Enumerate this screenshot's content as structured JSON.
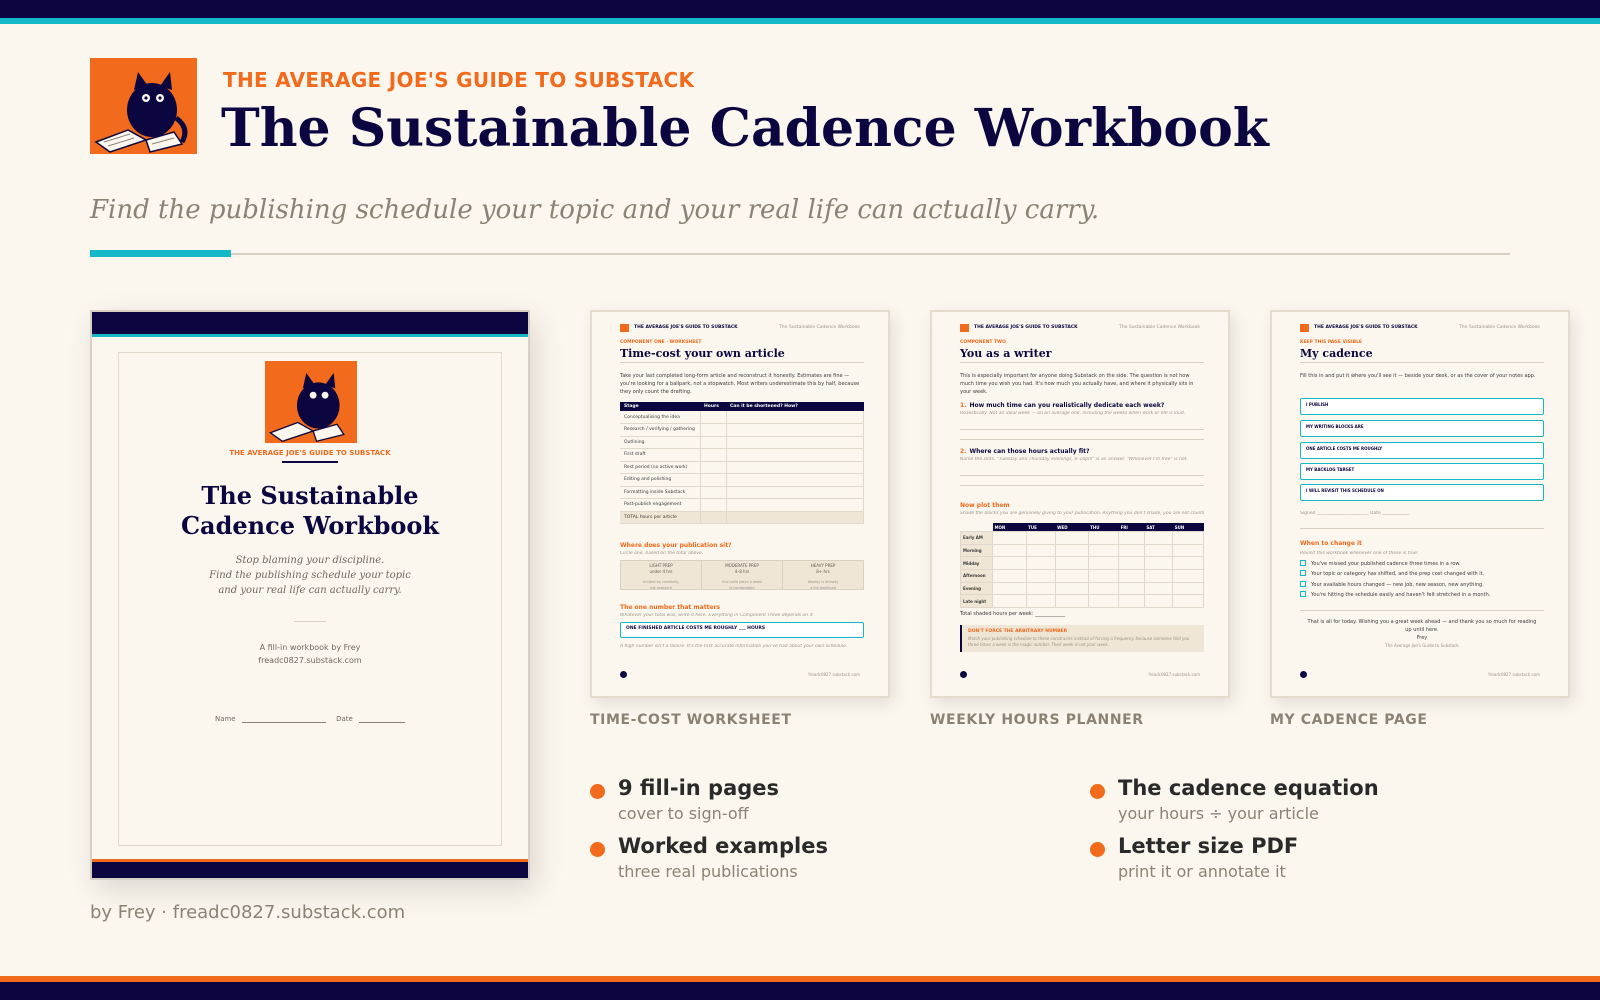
{
  "header": {
    "kicker": "THE AVERAGE JOE'S GUIDE TO SUBSTACK",
    "title": "The Sustainable Cadence Workbook",
    "subtitle": "Find the publishing schedule your topic and your real life can actually carry."
  },
  "cover": {
    "kicker": "THE AVERAGE JOE'S GUIDE TO SUBSTACK",
    "title_line1": "The Sustainable",
    "title_line2": "Cadence Workbook",
    "tagline_1": "Stop blaming your discipline.",
    "tagline_2": "Find the publishing schedule your topic",
    "tagline_3": "and your real life can actually carry.",
    "byline_1": "A fill-in workbook by Frey",
    "byline_2": "freadc0827.substack.com",
    "name_label": "Name",
    "date_label": "Date"
  },
  "byline": "by Frey  ·  freadc0827.substack.com",
  "pages": {
    "brand": "THE AVERAGE JOE'S GUIDE TO SUBSTACK",
    "brand_right": "The Sustainable Cadence Workbook",
    "footer_url": "freadc0827.substack.com",
    "timecost": {
      "label": "TIME-COST WORKSHEET",
      "kicker": "COMPONENT ONE · WORKSHEET",
      "title": "Time-cost your own article",
      "body": "Take your last completed long-form article and reconstruct it honestly. Estimates are fine — you're looking for a ballpark, not a stopwatch. Most writers underestimate this by half, because they only count the drafting.",
      "table_headers": [
        "Stage",
        "Hours",
        "Can it be shortened? How?"
      ],
      "stages": [
        "Conceptualising the idea",
        "Research / verifying / gathering",
        "Outlining",
        "First draft",
        "Rest period (no active work)",
        "Editing and polishing",
        "Formatting inside Substack",
        "Post-publish engagement"
      ],
      "total": "TOTAL hours per article",
      "sit_heading": "Where does your publication sit?",
      "sit_note": "Circle one, based on the total above.",
      "preps": [
        {
          "name": "LIGHT PREP",
          "range": "under 4 hrs",
          "note1": "Limited by creativity,",
          "note2": "not research"
        },
        {
          "name": "MODERATE PREP",
          "range": "4–8 hrs",
          "note1": "One solid piece a week",
          "note2": "is comfortable"
        },
        {
          "name": "HEAVY PREP",
          "range": "8+ hrs",
          "note1": "Weekly is already",
          "note2": "a full workload"
        }
      ],
      "number_heading": "The one number that matters",
      "number_note": "Whatever your total was, write it here. Everything in Component Three depends on it.",
      "box": "ONE FINISHED ARTICLE COSTS ME ROUGHLY ___ HOURS",
      "foot_note": "A high number isn't a failure. It's the first accurate information you've had about your own schedule."
    },
    "weekly": {
      "label": "WEEKLY HOURS PLANNER",
      "kicker": "COMPONENT TWO",
      "title": "You as a writer",
      "body": "This is especially important for anyone doing Substack on the side. The question is not how much time you wish you had. It's how much you actually have, and where it physically sits in your week.",
      "q1_num": "1.",
      "q1": "How much time can you realistically dedicate each week?",
      "q1_note": "Realistically. Not an ideal week — on an average one, including the weeks when work or life is loud.",
      "q2_num": "2.",
      "q2": "Where can those hours actually fit?",
      "q2_note": "Name the slots. \"Tuesday and Thursday evenings, 8–10pm\" is an answer. \"Whenever I'm free\" is not.",
      "plot_heading": "Now plot them",
      "plot_note": "Shade the blocks you are genuinely giving to your publication. Anything you don't shade, you are not counting on.",
      "days": [
        "MON",
        "TUE",
        "WED",
        "THU",
        "FRI",
        "SAT",
        "SUN"
      ],
      "slots": [
        "Early AM",
        "Morning",
        "Midday",
        "Afternoon",
        "Evening",
        "Late night"
      ],
      "total_line": "Total shaded hours per week: ____________",
      "callout_head": "DON'T FORCE THE ARBITRARY NUMBER",
      "callout_body": "Match your publishing schedule to these constraints instead of forcing a frequency because someone told you three times a week is the magic number. Their week is not your week."
    },
    "cadence": {
      "label": "MY CADENCE PAGE",
      "kicker": "KEEP THIS PAGE VISIBLE",
      "title": "My cadence",
      "body": "Fill this in and put it where you'll see it — beside your desk, or as the cover of your notes app.",
      "boxes": [
        "I PUBLISH",
        "MY WRITING BLOCKS ARE",
        "ONE ARTICLE COSTS ME ROUGHLY",
        "MY BACKLOG TARGET",
        "I WILL REVISIT THIS SCHEDULE ON"
      ],
      "signed": "Signed _______________________     Date ____________",
      "change_heading": "When to change it",
      "change_note": "Revisit this workbook whenever one of these is true:",
      "checks": [
        "You've missed your published cadence three times in a row.",
        "Your topic or category has shifted, and the prep cost changed with it.",
        "Your available hours changed — new job, new season, new anything.",
        "You're hitting the schedule easily and haven't felt stretched in a month."
      ],
      "signoff_1": "That is all for today. Wishing you a great week ahead — and thank you so much for reading",
      "signoff_2": "up until here.",
      "signoff_3": "Frey",
      "signoff_4": "The Average Joe's Guide to Substack"
    }
  },
  "features": [
    {
      "title": "9 fill-in pages",
      "sub": "cover to sign-off"
    },
    {
      "title": "Worked examples",
      "sub": "three real publications"
    },
    {
      "title": "The cadence equation",
      "sub": "your hours ÷ your article"
    },
    {
      "title": "Letter size PDF",
      "sub": "print it or annotate it"
    }
  ],
  "colors": {
    "navy": "#0c0640",
    "teal": "#14b9c8",
    "orange": "#f26a1b",
    "cream": "#fbf7ef"
  },
  "icons": {
    "logo": "cat-reading-book-icon",
    "bullet": "orange-dot-icon"
  }
}
